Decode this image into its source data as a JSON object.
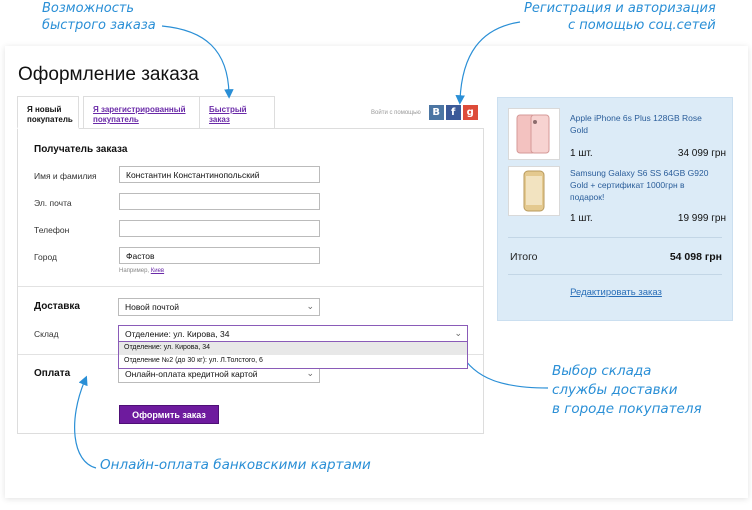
{
  "annotations": {
    "quick_order": [
      "Возможность",
      "быстрого заказа"
    ],
    "social": [
      "Регистрация и авторизация",
      "с помощью соц.сетей"
    ],
    "warehouse": [
      "Выбор склада",
      "службы доставки",
      "в городе покупателя"
    ],
    "payment": "Онлайн-оплата банковскими картами"
  },
  "page": {
    "title": "Оформление заказа"
  },
  "tabs": [
    {
      "label": [
        "Я новый",
        "покупатель"
      ],
      "active": true
    },
    {
      "label": [
        "Я зарегистрированный",
        "покупатель"
      ],
      "active": false
    },
    {
      "label": [
        "Быстрый",
        "заказ"
      ],
      "active": false
    }
  ],
  "social": {
    "label": "Войти с помощью",
    "buttons": [
      {
        "name": "vk-icon",
        "glyph": "B",
        "color": "#4c76a3"
      },
      {
        "name": "facebook-icon",
        "glyph": "f",
        "color": "#3b5998"
      },
      {
        "name": "google-plus-icon",
        "glyph": "g",
        "color": "#dd4b39"
      }
    ]
  },
  "form": {
    "recipient_title": "Получатель заказа",
    "fields": {
      "name": {
        "label": "Имя и фамилия",
        "value": "Константин Константинопольский"
      },
      "email": {
        "label": "Эл. почта",
        "value": ""
      },
      "phone": {
        "label": "Телефон",
        "value": ""
      },
      "city": {
        "label": "Город",
        "value": "Фастов",
        "hint_prefix": "Например, ",
        "hint_link": "Киев"
      }
    },
    "delivery": {
      "title": "Доставка",
      "value": "Новой почтой"
    },
    "warehouse": {
      "label": "Склад",
      "value": "Отделение: ул. Кирова, 34",
      "options": [
        "Отделение: ул. Кирова, 34",
        "Отделение №2 (до 30 кг): ул. Л.Толстого, 6"
      ]
    },
    "payment": {
      "title": "Оплата",
      "value": "Онлайн-оплата кредитной картой"
    },
    "submit_label": "Оформить заказ"
  },
  "cart": {
    "items": [
      {
        "name": "Apple iPhone 6s Plus 128GB Rose Gold",
        "qty": "1 шт.",
        "price": "34 099 грн"
      },
      {
        "name": "Samsung Galaxy S6 SS 64GB G920 Gold + сертификат 1000грн в подарок!",
        "qty": "1 шт.",
        "price": "19 999 грн"
      }
    ],
    "total_label": "Итого",
    "total_value": "54 098 грн",
    "edit_label": "Редактировать заказ"
  },
  "colors": {
    "accent": "#6e1b9e",
    "annotation": "#2a8fd6",
    "cart_bg": "#dcebf7",
    "link": "#2a6fb8"
  }
}
